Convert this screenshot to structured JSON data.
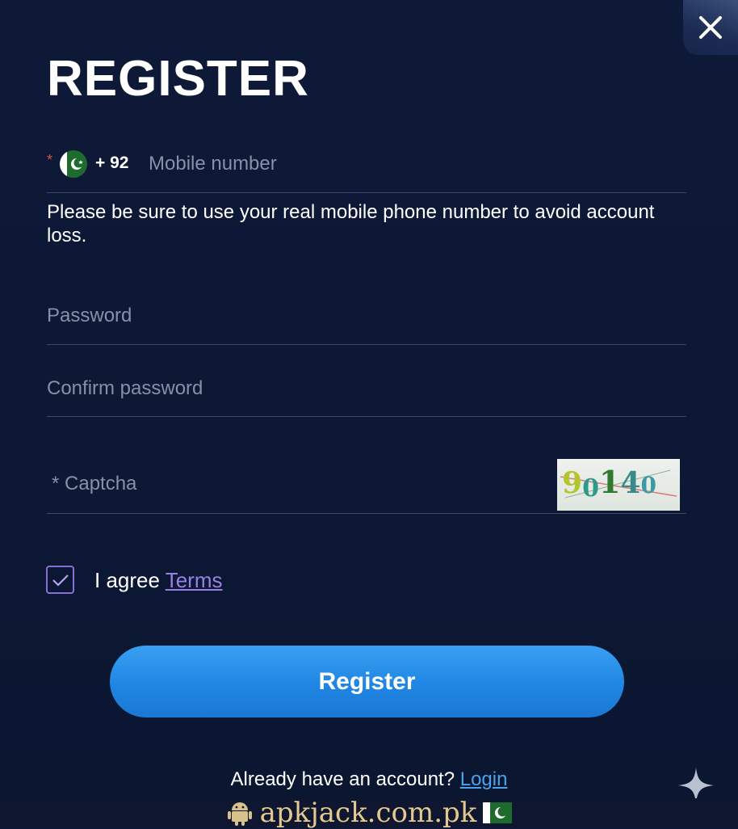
{
  "header": {
    "title": "REGISTER"
  },
  "phone": {
    "required_mark": "*",
    "country_code": "+ 92",
    "placeholder": "Mobile number"
  },
  "note": "Please be sure to use your real mobile phone number to avoid account loss.",
  "password": {
    "placeholder": "Password"
  },
  "confirm_password": {
    "placeholder": "Confirm password"
  },
  "captcha": {
    "placeholder": "* Captcha",
    "code": "90140"
  },
  "agree": {
    "checked": true,
    "text": "I agree",
    "link": "Terms"
  },
  "register_button": "Register",
  "footer": {
    "question": "Already have an account?",
    "login_link": "Login"
  },
  "watermark": {
    "text": "apkjack.com.pk"
  },
  "colors": {
    "background": "#0c1836",
    "button": "#2a90ec",
    "accent_purple": "#9a7fe6",
    "link_blue": "#4aa2ee"
  }
}
